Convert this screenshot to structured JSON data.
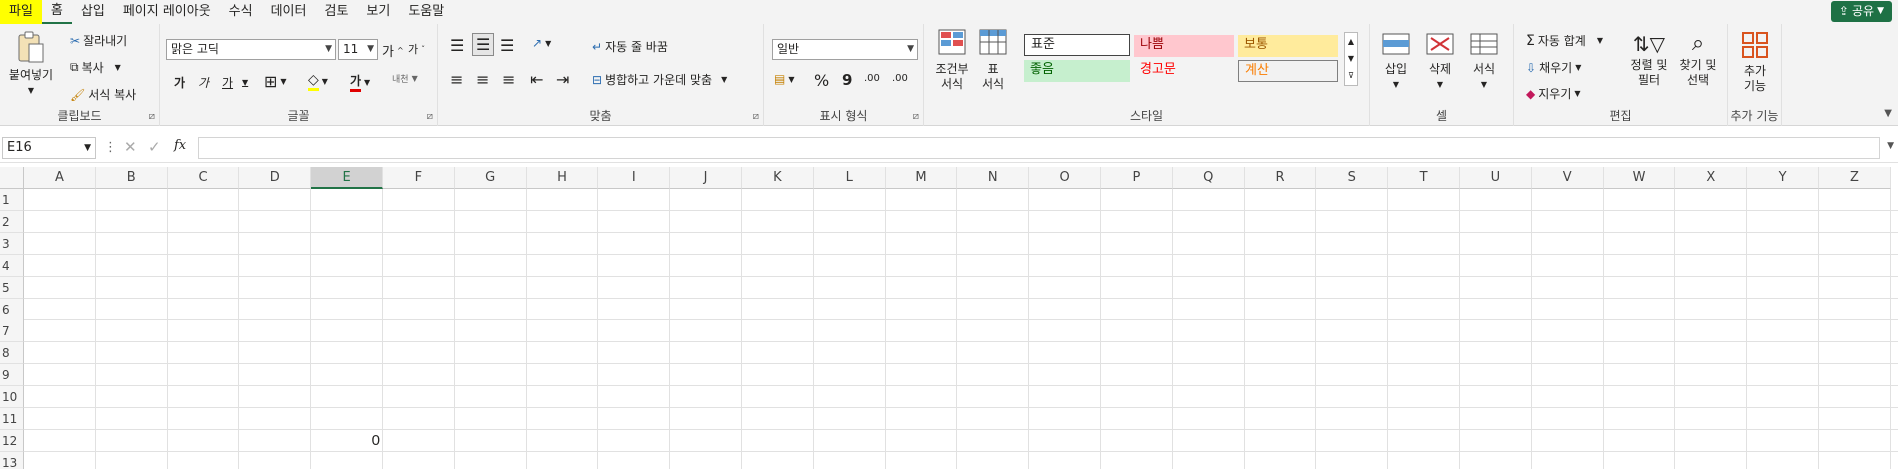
{
  "menu": {
    "tabs": [
      {
        "label": "파일"
      },
      {
        "label": "홈"
      },
      {
        "label": "삽입"
      },
      {
        "label": "페이지 레이아웃"
      },
      {
        "label": "수식"
      },
      {
        "label": "데이터"
      },
      {
        "label": "검토"
      },
      {
        "label": "보기"
      },
      {
        "label": "도움말"
      }
    ],
    "active_tab": "홈",
    "share_label": "공유"
  },
  "ribbon": {
    "clipboard": {
      "paste": "붙여넣기",
      "cut": "잘라내기",
      "copy": "복사",
      "format_painter": "서식 복사",
      "group": "클립보드"
    },
    "font": {
      "name": "맑은 고딕",
      "size": "11",
      "group": "글꼴",
      "bold": "가",
      "italic": "가",
      "underline": "가",
      "font_color_glyph": "가",
      "grow": "가",
      "shrink": "가",
      "phonetic": "내천"
    },
    "alignment": {
      "wrap": "자동 줄 바꿈",
      "merge": "병합하고 가운데 맞춤",
      "group": "맞춤"
    },
    "number": {
      "format": "일반",
      "group": "표시 형식",
      "percent": "%",
      "comma": "9",
      "inc_decimal": ".00",
      "dec_decimal": ".00"
    },
    "styles": {
      "conditional": "조건부 서식",
      "format_table": "표 서식",
      "normal": "표준",
      "bad": "나쁨",
      "neutral": "보통",
      "good": "좋음",
      "warning": "경고문",
      "calculation": "계산",
      "group": "스타일"
    },
    "cells": {
      "insert": "삽입",
      "delete": "삭제",
      "format": "서식",
      "group": "셀"
    },
    "editing": {
      "autosum": "자동 합계",
      "fill": "채우기",
      "clear": "지우기",
      "sort": "정렬 및 필터",
      "find": "찾기 및 선택",
      "group": "편집"
    },
    "addins": {
      "label": "추가 기능",
      "group": "추가 기능"
    }
  },
  "formula_bar": {
    "name_box": "E16",
    "fx": "fx",
    "value": ""
  },
  "sheet": {
    "columns": [
      "A",
      "B",
      "C",
      "D",
      "E",
      "F",
      "G",
      "H",
      "I",
      "J",
      "K",
      "L",
      "M",
      "N",
      "O",
      "P",
      "Q",
      "R",
      "S",
      "T",
      "U",
      "V",
      "W",
      "X",
      "Y",
      "Z"
    ],
    "selected_column": "E",
    "rows": [
      "1",
      "2",
      "3",
      "4",
      "5",
      "6",
      "7",
      "8",
      "9",
      "10",
      "11",
      "12",
      "13"
    ],
    "cells": [
      {
        "ref": "E12",
        "value": "0"
      }
    ]
  },
  "colors": {
    "accent": "#217346",
    "file_tab": "#ffff00",
    "bad_bg": "#ffc7ce",
    "neutral_bg": "#ffeb9c",
    "good_bg": "#c6efce"
  }
}
